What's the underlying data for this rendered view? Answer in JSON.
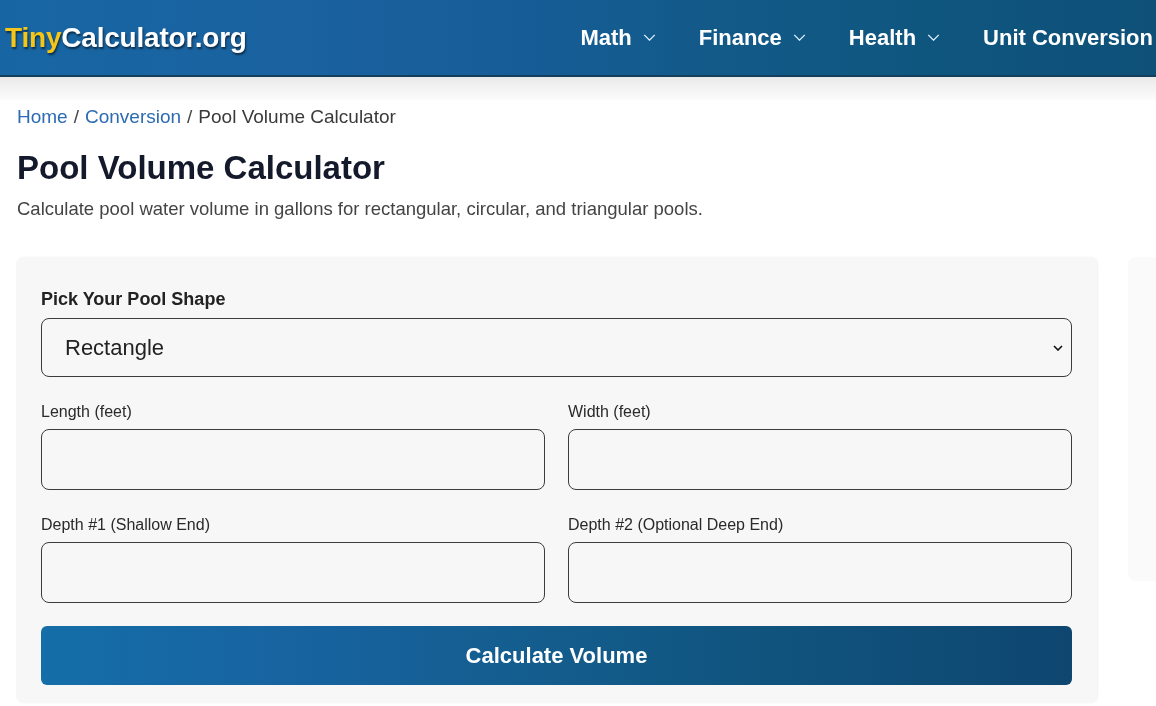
{
  "header": {
    "logo": {
      "accent": "Tiny",
      "text": "Calculator.org"
    },
    "nav": [
      {
        "label": "Math",
        "dropdown": true
      },
      {
        "label": "Finance",
        "dropdown": true
      },
      {
        "label": "Health",
        "dropdown": true
      },
      {
        "label": "Unit Conversion",
        "dropdown": false
      }
    ]
  },
  "breadcrumb": [
    {
      "kind": "link",
      "label": "Home"
    },
    {
      "kind": "separator",
      "label": "/"
    },
    {
      "kind": "link",
      "label": "Conversion"
    },
    {
      "kind": "separator",
      "label": "/"
    },
    {
      "kind": "current",
      "label": "Pool Volume Calculator"
    }
  ],
  "page": {
    "title": "Pool Volume Calculator",
    "subtitle": "Calculate pool water volume in gallons for rectangular, circular, and triangular pools."
  },
  "calculator": {
    "shape_select": {
      "label": "Pick Your Pool Shape",
      "value": "Rectangle"
    },
    "fields": [
      {
        "label": "Length (feet)"
      },
      {
        "label": "Width (feet)"
      },
      {
        "label": "Depth #1 (Shallow End)"
      },
      {
        "label": "Depth #2 (Optional Deep End)"
      }
    ],
    "button": "Calculate Volume"
  }
}
